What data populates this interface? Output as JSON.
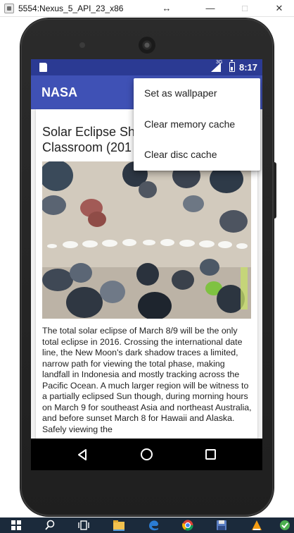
{
  "window": {
    "title": "5554:Nexus_5_API_23_x86",
    "controls": {
      "maximize_glyph": "↔",
      "minimize_glyph": "—",
      "restore_glyph": "□",
      "close_glyph": "✕"
    }
  },
  "status_bar": {
    "network": "3G",
    "time": "8:17"
  },
  "app_bar": {
    "title": "NASA"
  },
  "article": {
    "title": "Solar Eclipse Sh\nClassroom (201",
    "body": "The total solar eclipse of March 8/9 will be the only total eclipse in 2016. Crossing the international date line, the New Moon's dark shadow traces a limited, narrow path for viewing the total phase, making landfall in Indonesia and mostly tracking across the Pacific Ocean. A much larger region will be witness to a partially eclipsed Sun though, during morning hours on March 9 for southeast Asia and northeast Australia, and before sunset March 8 for Hawaii and Alaska. Safely viewing the"
  },
  "overflow_menu": {
    "items": [
      {
        "label": "Set as wallpaper"
      },
      {
        "label": "Clear memory cache"
      },
      {
        "label": "Clear disc cache"
      }
    ]
  },
  "nav_bar": {
    "icons": [
      "back-icon",
      "home-icon",
      "recents-icon"
    ]
  },
  "taskbar": {
    "icons": [
      "windows-start-icon",
      "search-icon",
      "task-view-icon",
      "file-explorer-icon",
      "edge-icon",
      "chrome-icon",
      "save-icon",
      "vlc-icon",
      "app-icon"
    ]
  },
  "colors": {
    "status_bar": "#2b3a93",
    "app_bar": "#3f51b5",
    "nav_bar": "#000000",
    "taskbar": "#1b2a3b"
  }
}
